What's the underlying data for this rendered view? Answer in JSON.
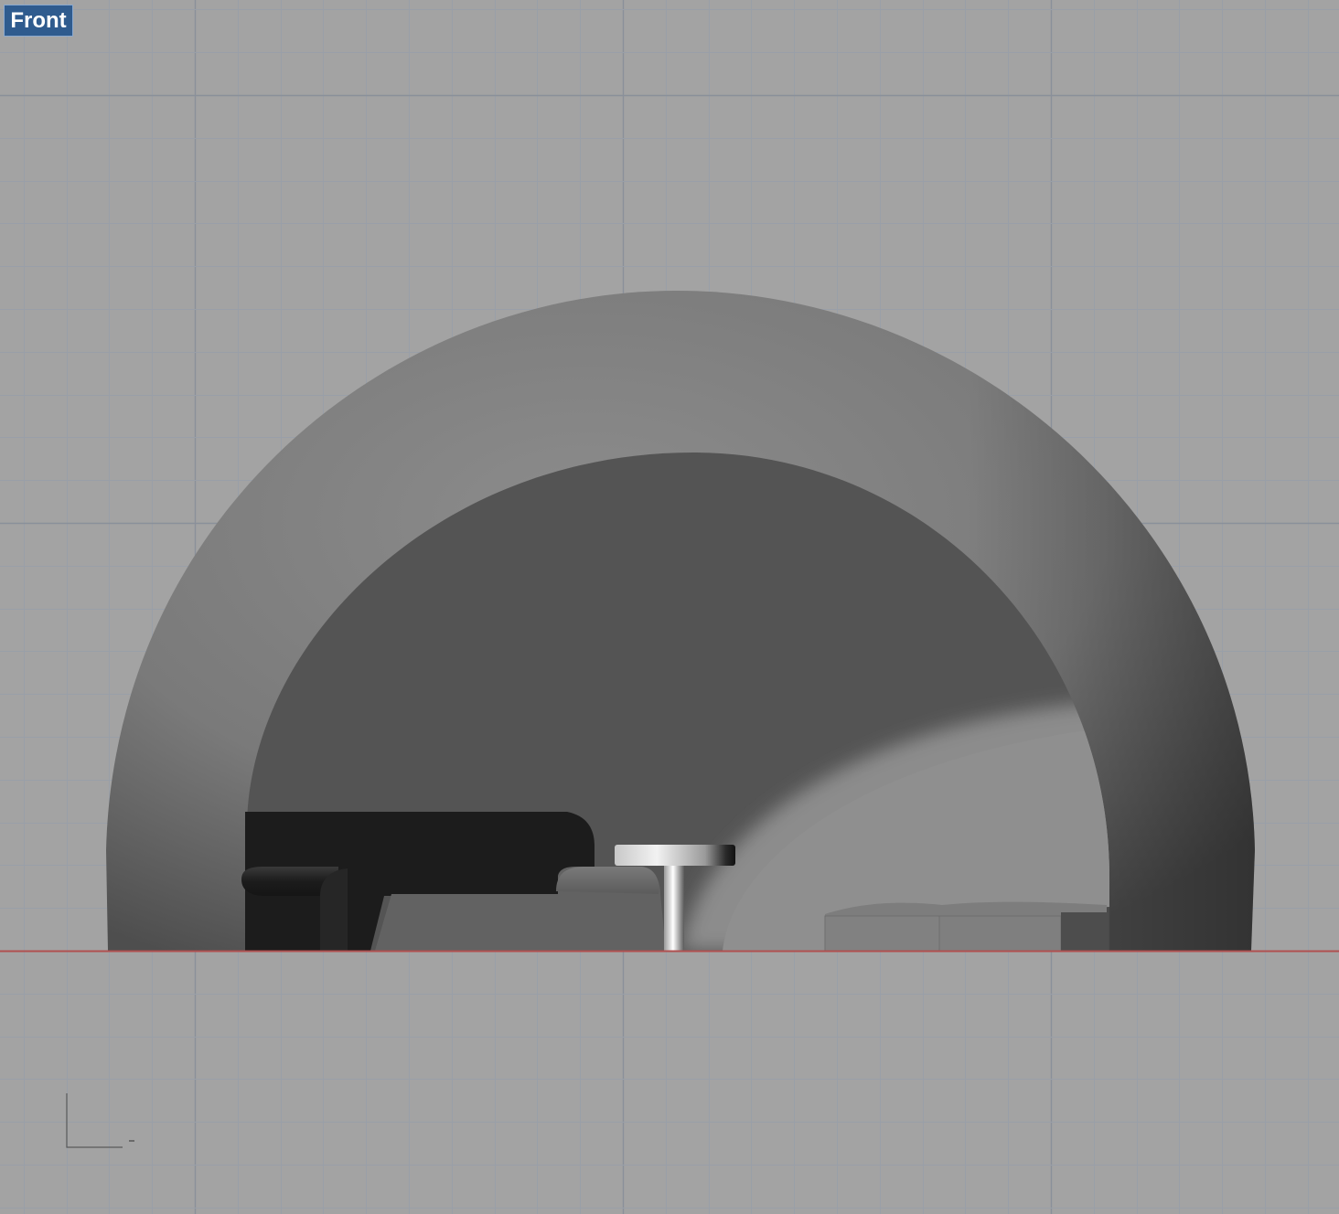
{
  "viewport": {
    "label": "Front",
    "display_mode": "shaded",
    "background_color": "#a3a3a3",
    "minor_grid_color": "#999fa8",
    "major_grid_color": "#8a909a",
    "x_axis_color": "#b05050",
    "object_color": "#808080"
  },
  "axis_indicator": {
    "icon": "world-axes-icon"
  }
}
